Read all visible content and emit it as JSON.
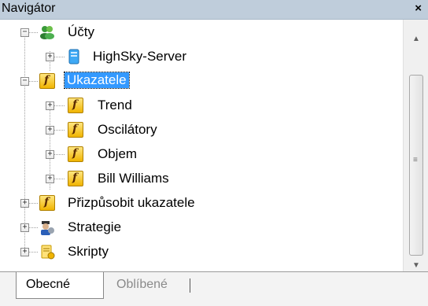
{
  "window": {
    "title": "Navigátor",
    "close_glyph": "×"
  },
  "tree": {
    "accounts": {
      "label": "Účty",
      "icon": "accounts-icon",
      "expander": "−",
      "children": [
        {
          "label": "HighSky-Server",
          "icon": "server-icon",
          "expander": "+"
        }
      ]
    },
    "indicators": {
      "label": "Ukazatele",
      "icon": "function-icon",
      "expander": "−",
      "selected": true,
      "children": [
        {
          "label": "Trend",
          "icon": "function-icon",
          "expander": "+"
        },
        {
          "label": "Oscilátory",
          "icon": "function-icon",
          "expander": "+"
        },
        {
          "label": "Objem",
          "icon": "function-icon",
          "expander": "+"
        },
        {
          "label": "Bill Williams",
          "icon": "function-icon",
          "expander": "+"
        }
      ]
    },
    "custom_indicators": {
      "label": "Přizpůsobit ukazatele",
      "icon": "custom-function-icon",
      "expander": "+"
    },
    "strategies": {
      "label": "Strategie",
      "icon": "strategy-icon",
      "expander": "+"
    },
    "scripts": {
      "label": "Skripty",
      "icon": "script-icon",
      "expander": "+"
    }
  },
  "tabs": [
    {
      "label": "Obecné",
      "active": true
    },
    {
      "label": "Oblíbené",
      "active": false
    }
  ],
  "colors": {
    "selection": "#3399ff",
    "titlebar": "#bfcddb",
    "function_icon": "#f0b400"
  }
}
